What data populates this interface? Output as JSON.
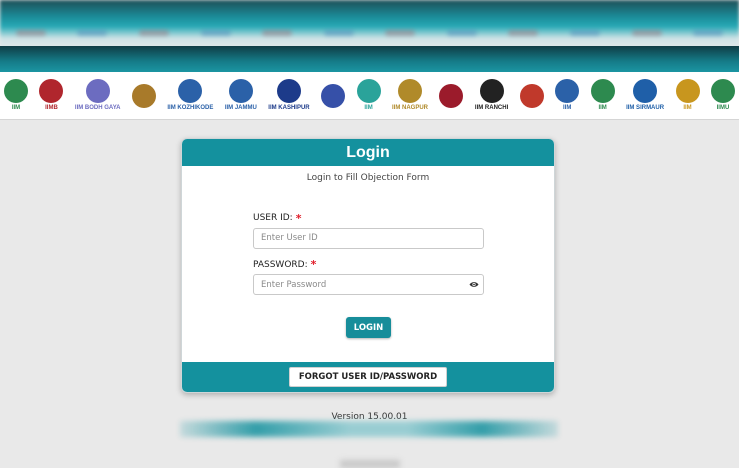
{
  "logos": [
    {
      "label": "IIM",
      "color": "#2d8a4f"
    },
    {
      "label": "IIMB",
      "color": "#b0262d"
    },
    {
      "label": "IIM BODH GAYA",
      "color": "#6c6cc0"
    },
    {
      "label": "",
      "color": "#a87a2a"
    },
    {
      "label": "IIM KOZHIKODE",
      "color": "#2b61a8"
    },
    {
      "label": "IIM JAMMU",
      "color": "#2b61a8"
    },
    {
      "label": "IIM KASHIPUR",
      "color": "#1d3b8a"
    },
    {
      "label": "",
      "color": "#3650a8"
    },
    {
      "label": "IIM",
      "color": "#2aa39a"
    },
    {
      "label": "IIM NAGPUR",
      "color": "#b08a2a"
    },
    {
      "label": "",
      "color": "#9b1b2b"
    },
    {
      "label": "IIM RANCHI",
      "color": "#222222"
    },
    {
      "label": "",
      "color": "#c0392b"
    },
    {
      "label": "IIM",
      "color": "#2b61a8"
    },
    {
      "label": "IIM",
      "color": "#2d8a4f"
    },
    {
      "label": "IIM SIRMAUR",
      "color": "#1f5fa8"
    },
    {
      "label": "IIM",
      "color": "#c8961e"
    },
    {
      "label": "IIMU",
      "color": "#2d8a4f"
    }
  ],
  "login": {
    "title": "Login",
    "subtitle": "Login to Fill Objection Form",
    "user_id_label": "USER ID:",
    "user_id_placeholder": "Enter User ID",
    "password_label": "PASSWORD:",
    "password_placeholder": "Enter Password",
    "required_mark": "*",
    "login_button": "LOGIN",
    "forgot_button": "FORGOT USER ID/PASSWORD"
  },
  "footer": {
    "version": "Version 15.00.01"
  },
  "colors": {
    "accent": "#14919e",
    "required": "#e11d2a"
  }
}
